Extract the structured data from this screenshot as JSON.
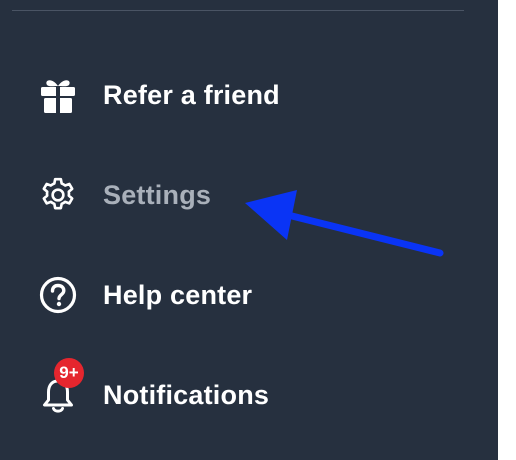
{
  "sidebar": {
    "items": [
      {
        "label": "Refer a friend",
        "icon": "gift-icon"
      },
      {
        "label": "Settings",
        "icon": "gear-icon"
      },
      {
        "label": "Help center",
        "icon": "question-circle-icon"
      },
      {
        "label": "Notifications",
        "icon": "bell-icon",
        "badge": "9+"
      }
    ]
  },
  "colors": {
    "sidebar_background": "#26303f",
    "item_text": "#ffffff",
    "item_text_dimmed": "#a9b0ba",
    "badge": "#e5262e",
    "annotation_arrow": "#0a34f5"
  },
  "annotation": {
    "type": "arrow",
    "points_to": "Settings"
  }
}
